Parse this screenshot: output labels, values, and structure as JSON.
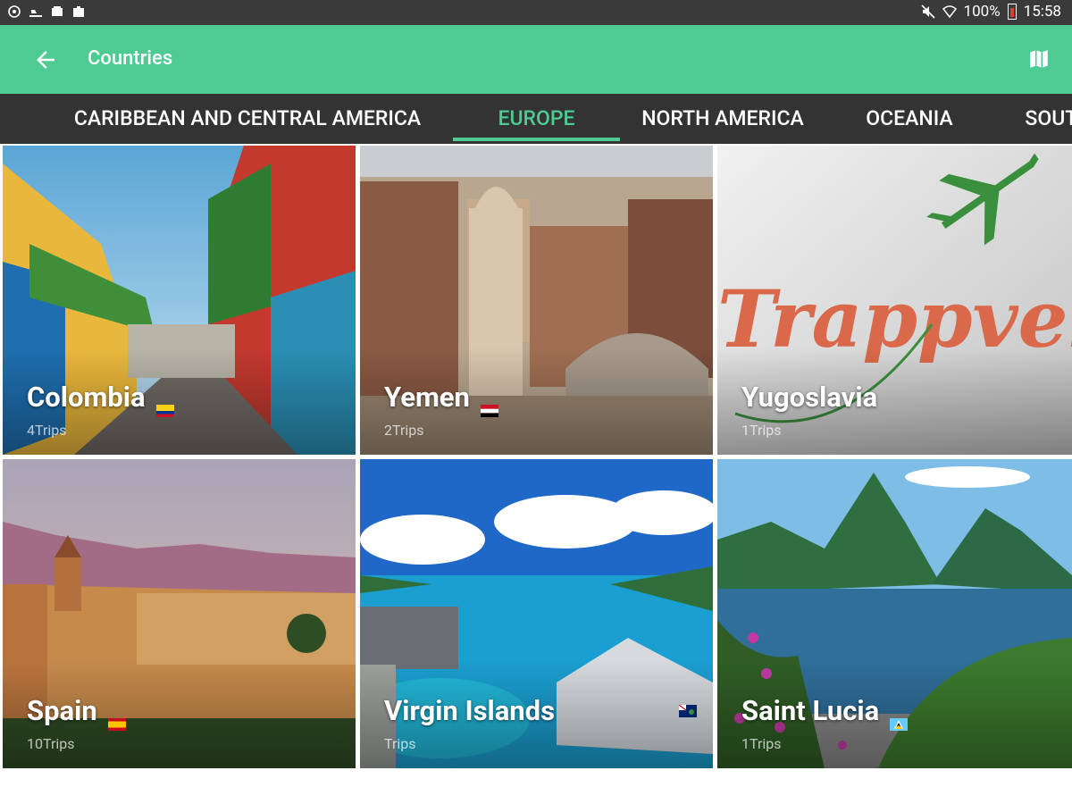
{
  "status_bar": {
    "battery": "100%",
    "time": "15:58",
    "left_icons": [
      "settings-icon",
      "cast-icon",
      "photo-icon",
      "briefcase-icon"
    ],
    "right_icons": [
      "mute-icon",
      "wifi-icon",
      "battery-icon"
    ]
  },
  "appbar": {
    "title": "Countries",
    "color": "#4dcb93",
    "back_icon": "arrow-left-icon",
    "action_icon": "map-icon"
  },
  "tabs": [
    {
      "label": "CARIBBEAN AND CENTRAL AMERICA",
      "active": false
    },
    {
      "label": "EUROPE",
      "active": true
    },
    {
      "label": "NORTH AMERICA",
      "active": false
    },
    {
      "label": "OCEANIA",
      "active": false
    },
    {
      "label": "SOUTH",
      "active": false
    }
  ],
  "countries": [
    {
      "name": "Colombia",
      "trips": "4Trips",
      "flag": [
        "#fcd116",
        "#003893",
        "#ce1126"
      ]
    },
    {
      "name": "Yemen",
      "trips": "2Trips",
      "flag": [
        "#ce1126",
        "#ffffff",
        "#000000"
      ]
    },
    {
      "name": "Yugoslavia",
      "trips": "1Trips",
      "flag": []
    },
    {
      "name": "Spain",
      "trips": "10Trips",
      "flag": [
        "#c60b1e",
        "#ffc400",
        "#c60b1e"
      ]
    },
    {
      "name": "Virgin Islands",
      "trips": "Trips",
      "flag": [
        "#012169",
        "#012169",
        "#012169"
      ]
    },
    {
      "name": "Saint Lucia",
      "trips": "1Trips",
      "flag": [
        "#66ccff",
        "#fcd116",
        "#66ccff"
      ]
    }
  ],
  "logo_text": "Trappveller"
}
